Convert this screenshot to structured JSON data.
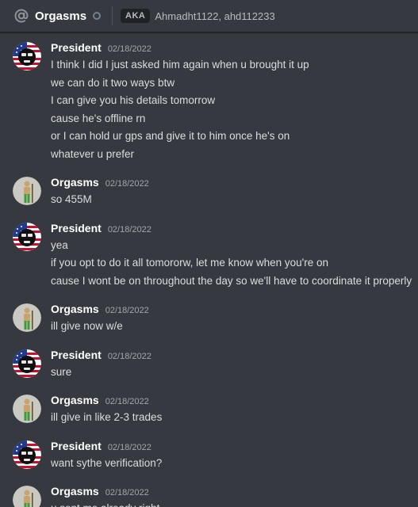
{
  "header": {
    "title": "Orgasms",
    "aka_label": "AKA",
    "aka_names": "Ahmadht1122, ahd112233"
  },
  "icons": {
    "at": "at-sign-icon",
    "status": "offline-status-icon"
  },
  "colors": {
    "background": "#36393f",
    "header_border": "#202225",
    "text": "#dcddde",
    "timestamp": "#a3a6aa",
    "offline": "#747f8d"
  },
  "messages": [
    {
      "author": "President",
      "timestamp": "02/18/2022",
      "avatar": "president-avatar",
      "lines": [
        "I think I did I just asked him again when u brought it up",
        "we can do it two ways btw",
        "I can give you his details tomorrow",
        "cause he's offline rn",
        "or I can hold ur gps and give it to him once he's on",
        "whatever u prefer"
      ]
    },
    {
      "author": "Orgasms",
      "timestamp": "02/18/2022",
      "avatar": "orgasms-avatar",
      "lines": [
        "so 455M"
      ]
    },
    {
      "author": "President",
      "timestamp": "02/18/2022",
      "avatar": "president-avatar",
      "lines": [
        "yea",
        "if you opt to do it all tomororw, let me know when you're on",
        "cause I wont be on throughout the day so we'll have to coordinate it properly"
      ]
    },
    {
      "author": "Orgasms",
      "timestamp": "02/18/2022",
      "avatar": "orgasms-avatar",
      "lines": [
        "ill give now w/e"
      ]
    },
    {
      "author": "President",
      "timestamp": "02/18/2022",
      "avatar": "president-avatar",
      "lines": [
        "sure"
      ]
    },
    {
      "author": "Orgasms",
      "timestamp": "02/18/2022",
      "avatar": "orgasms-avatar",
      "lines": [
        "ill give in like 2-3 trades"
      ]
    },
    {
      "author": "President",
      "timestamp": "02/18/2022",
      "avatar": "president-avatar",
      "lines": [
        "want sythe verification?"
      ]
    },
    {
      "author": "Orgasms",
      "timestamp": "02/18/2022",
      "avatar": "orgasms-avatar",
      "lines": [
        "u sent me already right"
      ]
    }
  ]
}
